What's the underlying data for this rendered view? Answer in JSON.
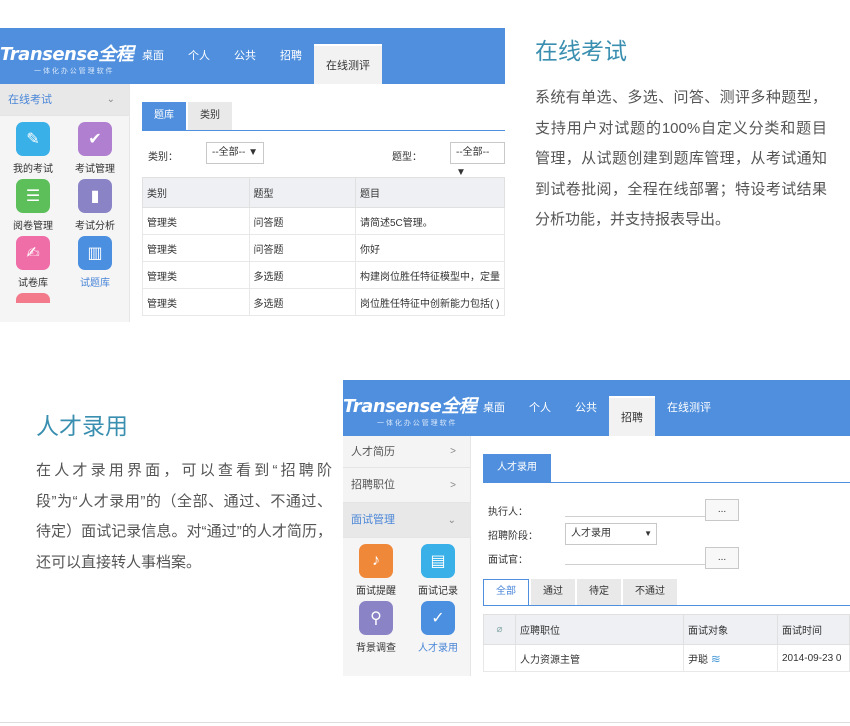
{
  "section1": {
    "heading": "在线考试",
    "description": "系统有单选、多选、问答、测评多种题型，支持用户对试题的100%自定义分类和题目管理，从试题创建到题库管理，从考试通知到试卷批阅，全程在线部署；特设考试结果分析功能，并支持报表导出。",
    "app": {
      "logo": "Transense全程",
      "logo_sub": "一 体 化 办 公 管 理 软 件",
      "nav": [
        "桌面",
        "个人",
        "公共",
        "招聘",
        "在线测评"
      ],
      "sidebar_header": "在线考试",
      "tiles": [
        {
          "label": "我的考试",
          "icon": "certificate-icon",
          "color": "#3ab0e8",
          "glyph": "✎"
        },
        {
          "label": "考试管理",
          "icon": "calendar-check-icon",
          "color": "#b07fd0",
          "glyph": "✔"
        },
        {
          "label": "阅卷管理",
          "icon": "document-icon",
          "color": "#5cbf5a",
          "glyph": "☰"
        },
        {
          "label": "考试分析",
          "icon": "bar-chart-icon",
          "color": "#8a84c6",
          "glyph": "▮"
        },
        {
          "label": "试卷库",
          "icon": "edit-paper-icon",
          "color": "#f06ea8",
          "glyph": "✍"
        },
        {
          "label": "试题库",
          "icon": "books-icon",
          "color": "#4a8fe0",
          "glyph": "▥"
        }
      ],
      "tabs": [
        "题库",
        "类别"
      ],
      "filter_category_label": "类别：",
      "filter_category_value": "--全部-- ▼",
      "filter_type_label": "题型：",
      "filter_type_value": "--全部-- ▼",
      "table_headers": [
        "类别",
        "题型",
        "题目"
      ],
      "table_rows": [
        [
          "管理类",
          "问答题",
          "请简述5C管理。"
        ],
        [
          "管理类",
          "问答题",
          "你好"
        ],
        [
          "管理类",
          "多选题",
          "构建岗位胜任特征模型中，定量"
        ],
        [
          "管理类",
          "多选题",
          "岗位胜任特征中创新能力包括( )"
        ]
      ]
    }
  },
  "section2": {
    "heading": "人才录用",
    "description": "在人才录用界面，可以查看到“招聘阶段”为“人才录用”的（全部、通过、不通过、待定）面试记录信息。对“通过”的人才简历，还可以直接转人事档案。",
    "app": {
      "logo": "Transense全程",
      "logo_sub": "一 体 化 办 公 管 理 软 件",
      "nav": [
        "桌面",
        "个人",
        "公共",
        "招聘",
        "在线测评"
      ],
      "sidebar_items": [
        {
          "label": "人才简历",
          "chevron": ">"
        },
        {
          "label": "招聘职位",
          "chevron": ">"
        },
        {
          "label": "面试管理",
          "chevron": "⌄"
        }
      ],
      "tiles": [
        {
          "label": "面试提醒",
          "icon": "bell-icon",
          "color": "#f0883a",
          "glyph": "♪"
        },
        {
          "label": "面试记录",
          "icon": "notebook-icon",
          "color": "#3ab0e8",
          "glyph": "▤"
        },
        {
          "label": "背景调查",
          "icon": "search-document-icon",
          "color": "#8a84c6",
          "glyph": "⚲"
        },
        {
          "label": "人才录用",
          "icon": "clipboard-icon",
          "color": "#4a8fe0",
          "glyph": "✓"
        }
      ],
      "panel_tab": "人才录用",
      "form": {
        "executor_label": "执行人：",
        "stage_label": "招聘阶段：",
        "stage_value": "人才录用",
        "interviewer_label": "面试官：",
        "dots": "..."
      },
      "status_tabs": [
        "全部",
        "通过",
        "待定",
        "不通过"
      ],
      "table_headers": [
        "应聘职位",
        "面试对象",
        "面试时间"
      ],
      "table_rows": [
        [
          "人力资源主管",
          "尹聪",
          "2014-09-23 0"
        ]
      ]
    }
  }
}
